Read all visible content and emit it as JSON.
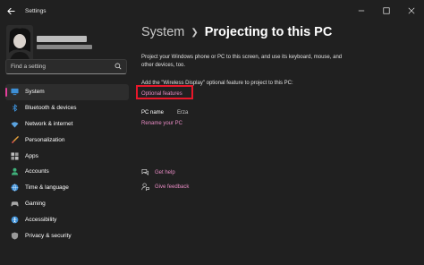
{
  "window": {
    "app_title": "Settings",
    "controls": [
      "minimize",
      "maximize",
      "close"
    ]
  },
  "search": {
    "placeholder": "Find a setting",
    "value": ""
  },
  "sidebar": {
    "items": [
      {
        "label": "System",
        "icon": "system-icon",
        "active": true
      },
      {
        "label": "Bluetooth & devices",
        "icon": "bluetooth-icon",
        "active": false
      },
      {
        "label": "Network & internet",
        "icon": "network-icon",
        "active": false
      },
      {
        "label": "Personalization",
        "icon": "brush-icon",
        "active": false
      },
      {
        "label": "Apps",
        "icon": "apps-icon",
        "active": false
      },
      {
        "label": "Accounts",
        "icon": "accounts-icon",
        "active": false
      },
      {
        "label": "Time & language",
        "icon": "globe-icon",
        "active": false
      },
      {
        "label": "Gaming",
        "icon": "gaming-icon",
        "active": false
      },
      {
        "label": "Accessibility",
        "icon": "accessibility-icon",
        "active": false
      },
      {
        "label": "Privacy & security",
        "icon": "shield-icon",
        "active": false
      }
    ]
  },
  "main": {
    "breadcrumb_parent": "System",
    "breadcrumb_current": "Projecting to this PC",
    "description": "Project your Windows phone or PC to this screen, and use its keyboard, mouse, and other devices, too.",
    "add_feature_text": "Add the \"Wireless Display\" optional feature to project to this PC:",
    "optional_features_link": "Optional features",
    "pc_name_label": "PC name",
    "pc_name_value": "Erza",
    "rename_link": "Rename your PC",
    "get_help": "Get help",
    "give_feedback": "Give feedback"
  },
  "colors": {
    "background": "#202020",
    "accent": "#e88bc4",
    "highlight_box": "#e8172a"
  }
}
